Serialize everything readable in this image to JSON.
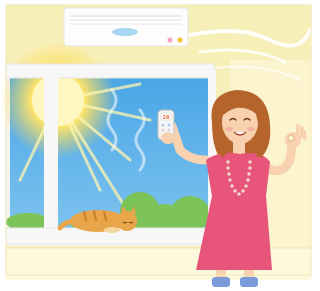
{
  "remote": {
    "display": "28"
  },
  "colors": {
    "wall": "#f7efb8",
    "wall_light": "#fbf6d6",
    "floor": "#fdf9dc",
    "ac_body": "#fdfdfd",
    "ac_vent": "#a7d7f2",
    "ac_light_pink": "#f4a6c8",
    "ac_light_yellow": "#f2c230",
    "sky": "#5aaee8",
    "sun": "#ffd84a",
    "window_frame": "#f4f4f4",
    "cat": "#e8a54a",
    "dress": "#e8557a",
    "hair": "#b5642c",
    "skin": "#f8d2b0",
    "shoes": "#7a9ad8",
    "grass": "#7cc45a"
  },
  "icons": [
    "air-conditioner-icon",
    "sun-icon",
    "cat-icon",
    "remote-control-icon",
    "ok-hand-gesture-icon"
  ]
}
